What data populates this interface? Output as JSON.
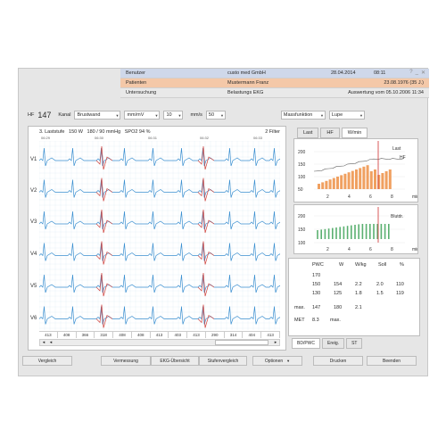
{
  "header": {
    "rows": [
      {
        "label": "Benutzer",
        "value": "custo med GmbH",
        "date": "28.04.2014",
        "time": "08:11"
      },
      {
        "label": "Patienten",
        "value": "Mustermann Franz",
        "right": "23.08.1976 (35 J.)"
      },
      {
        "label": "Untersuchung",
        "value": "Belastungs EKG",
        "right": "Auswertung vom 05.10.2006 11:34"
      }
    ],
    "icons": [
      "help-icon",
      "minimize-icon",
      "close-icon"
    ]
  },
  "toolbar": {
    "hf_label": "HF",
    "hf_value": "147",
    "kanal_label": "Kanal",
    "kanal_value": "Brustwand",
    "unit_select": "mm/mV",
    "gain_value": "10",
    "speed_unit": "mm/s",
    "speed_value": "50",
    "mode_select": "Massfunktion",
    "lupe_select": "Lupe"
  },
  "ecg": {
    "stage_text": "3. Laststufe",
    "watt": "150 W",
    "bp": "180 / 90 mmHg",
    "spo2": "SPO2 94 %",
    "filter": "2 Filter",
    "times": [
      "06:29",
      "06:30",
      "06:31",
      "06:32",
      "06:33"
    ],
    "leads": [
      "V1",
      "V2",
      "V3",
      "V4",
      "V5",
      "V6"
    ],
    "rr_values": [
      "413",
      "408",
      "366",
      "318",
      "408",
      "408",
      "413",
      "403",
      "413",
      "290",
      "314",
      "404",
      "413"
    ]
  },
  "right": {
    "tabs": [
      "Last",
      "HF",
      "W/min"
    ],
    "chart1": {
      "ylabels": [
        "200",
        "150",
        "100",
        "50"
      ],
      "xlabels": [
        "2",
        "4",
        "6",
        "8",
        "min"
      ],
      "label_last": "Last",
      "label_hf": "HF"
    },
    "chart2": {
      "ylabels": [
        "200",
        "150",
        "100"
      ],
      "xlabels": [
        "2",
        "4",
        "6",
        "8",
        "min"
      ],
      "label": "Blutdr."
    },
    "table": {
      "headers": [
        "PWC",
        "W",
        "W/kg",
        "Soll",
        "%"
      ],
      "rows": [
        [
          "170",
          "",
          "",
          "",
          ""
        ],
        [
          "150",
          "154",
          "2.2",
          "2.0",
          "110"
        ],
        [
          "130",
          "125",
          "1.8",
          "1.5",
          "119"
        ]
      ],
      "max_label": "max.",
      "max_vals": [
        "147",
        "180",
        "2.1"
      ],
      "met_label": "MET",
      "met_val": "8.3",
      "met_max": "max."
    },
    "bottom_tabs": [
      "BD/PWC",
      "Ereig.",
      "ST"
    ]
  },
  "footer": {
    "vergleich": "Vergleich",
    "vermessung": "Vermessung",
    "ekg_uebersicht": "EKG-Übersicht",
    "stufenvergleich": "Stufenvergleich",
    "optionen": "Optionen",
    "drucken": "Drucken",
    "beenden": "Beenden"
  },
  "colors": {
    "blue_trace": "#3a8fd0",
    "red_trace": "#d0403a",
    "orange_bar": "#f0a060",
    "green_bar": "#5ab070",
    "grid": "#e3eef6"
  }
}
